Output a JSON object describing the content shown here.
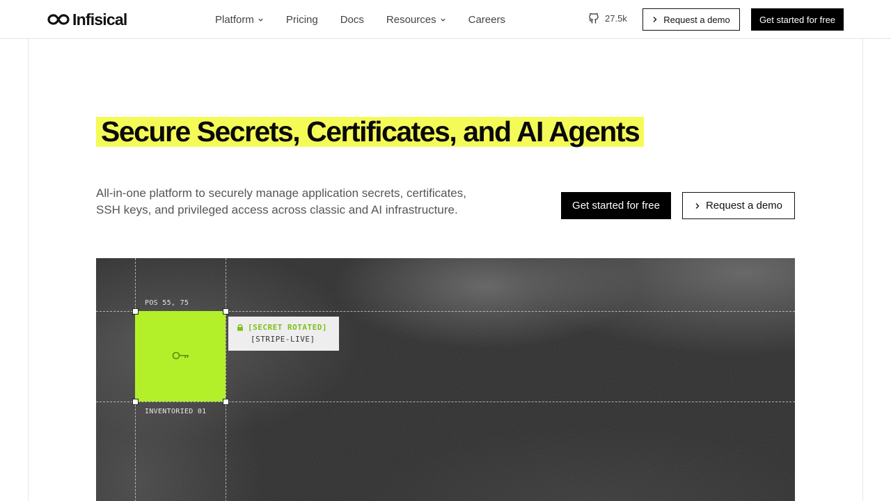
{
  "header": {
    "logo_text": "Infisical",
    "nav": [
      {
        "label": "Platform",
        "has_dropdown": true
      },
      {
        "label": "Pricing",
        "has_dropdown": false
      },
      {
        "label": "Docs",
        "has_dropdown": false
      },
      {
        "label": "Resources",
        "has_dropdown": true
      },
      {
        "label": "Careers",
        "has_dropdown": false
      }
    ],
    "github_stars": "27.5k",
    "request_demo_label": "Request a demo",
    "get_started_label": "Get started for free"
  },
  "hero": {
    "headline": "Secure Secrets, Certificates, and AI Agents",
    "subtitle": "All-in-one platform to securely manage application secrets, certificates, SSH keys, and privileged access across classic and AI infrastructure.",
    "primary_cta": "Get started for free",
    "secondary_cta": "Request a demo"
  },
  "visual": {
    "position_label": "POS 55, 75",
    "inventory_label": "INVENTORIED 01",
    "tooltip": {
      "status": "[SECRET ROTATED]",
      "name": "[STRIPE-LIVE]"
    }
  },
  "colors": {
    "highlight": "#f4fb56",
    "accent_green": "#b3f02a",
    "tooltip_green": "#7fbf1a",
    "primary_button": "#000000"
  }
}
